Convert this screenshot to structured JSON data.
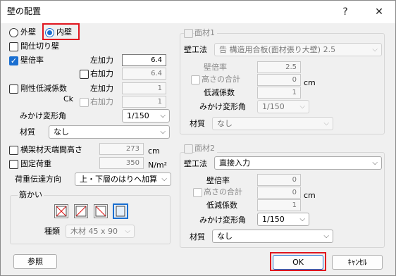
{
  "window": {
    "title": "壁の配置",
    "help": "?",
    "close": "✕"
  },
  "wall_type": {
    "outer": "外壁",
    "inner": "内壁",
    "selected": "inner"
  },
  "pillar_cut": {
    "label": "間仕切り壁",
    "checked": false
  },
  "wall_ratio": {
    "label": "壁倍率",
    "checked": true,
    "left_label": "左加力",
    "left_value": "6.4",
    "right_label": "右加力",
    "right_checked": false,
    "right_value": "6.4"
  },
  "rigidity": {
    "label": "剛性低減係数",
    "checked": false,
    "ck": "Ck",
    "left_label": "左加力",
    "left_value": "1",
    "right_label": "右加力",
    "right_checked": false,
    "right_value": "1"
  },
  "deform": {
    "label": "みかけ変形角",
    "value": "1/150"
  },
  "material": {
    "label": "材質",
    "value": "なし"
  },
  "beam_height": {
    "label": "横架材天端間高さ",
    "checked": false,
    "value": "273",
    "unit": "cm"
  },
  "fixed_load": {
    "label": "固定荷重",
    "checked": false,
    "value": "350",
    "unit": "N/m²"
  },
  "load_transfer": {
    "label": "荷重伝達方向",
    "value": "上・下層のはりへ加算"
  },
  "brace": {
    "group_label": "筋かい",
    "type_label": "種類",
    "type_value": "木材 45 x 90",
    "icons": [
      "brace-x-icon",
      "brace-slash-icon",
      "brace-backslash-icon",
      "brace-none-icon"
    ],
    "selected_index": 3
  },
  "face1": {
    "title": "面材1",
    "checked": false,
    "method_label": "壁工法",
    "method_value": "告 構造用合板(面材張り大壁) 2.5",
    "ratio_label": "壁倍率",
    "ratio_value": "2.5",
    "height_label": "高さの合計",
    "height_value": "0",
    "unit": "cm",
    "reduction_label": "低減係数",
    "reduction_value": "1",
    "deform_label": "みかけ変形角",
    "deform_value": "1/150",
    "material_label": "材質",
    "material_value": "なし"
  },
  "face2": {
    "title": "面材2",
    "checked": false,
    "method_label": "壁工法",
    "method_value": "直接入力",
    "ratio_label": "壁倍率",
    "ratio_value": "0",
    "height_label": "高さの合計",
    "height_value": "0",
    "unit": "cm",
    "reduction_label": "低減係数",
    "reduction_value": "1",
    "deform_label": "みかけ変形角",
    "deform_value": "1/150",
    "material_label": "材質",
    "material_value": "なし"
  },
  "buttons": {
    "ref": "参照",
    "ok": "OK",
    "cancel": "ｷｬﾝｾﾙ"
  },
  "colors": {
    "accent": "#1a6fd1",
    "highlight": "#e0161f"
  }
}
